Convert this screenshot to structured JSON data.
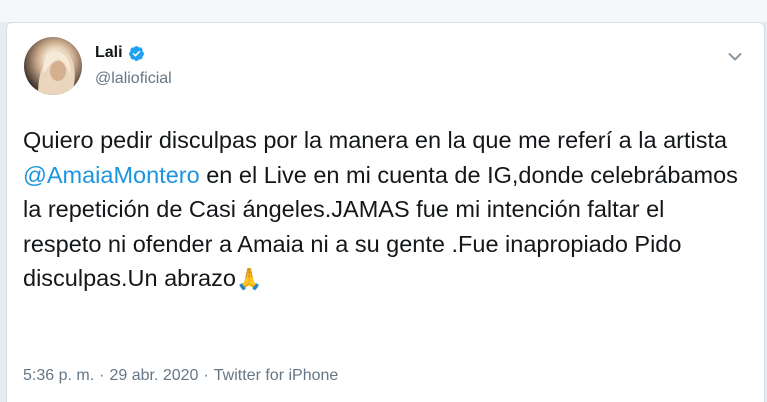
{
  "tweet": {
    "author_name": "Lali",
    "author_handle": "@lalioficial",
    "text_before": "Quiero pedir disculpas por la manera en la que me referí a la artista ",
    "mention": "@AmaiaMontero",
    "text_after": " en el Live en mi cuenta de IG,donde celebrábamos la repetición de Casi ángeles.JAMAS fue mi intención faltar el respeto ni ofender a Amaia ni a su gente .Fue inapropiado Pido disculpas.Un abrazo",
    "emoji": "🙏",
    "time": "5:36 p. m.",
    "date": "29 abr. 2020",
    "source": "Twitter for iPhone",
    "separator": "·"
  },
  "icons": {
    "verified": "verified-badge-icon",
    "caret": "chevron-down-icon"
  },
  "colors": {
    "link": "#1b95e0",
    "text": "#14171a",
    "secondary": "#657786",
    "verified": "#1da1f2"
  }
}
